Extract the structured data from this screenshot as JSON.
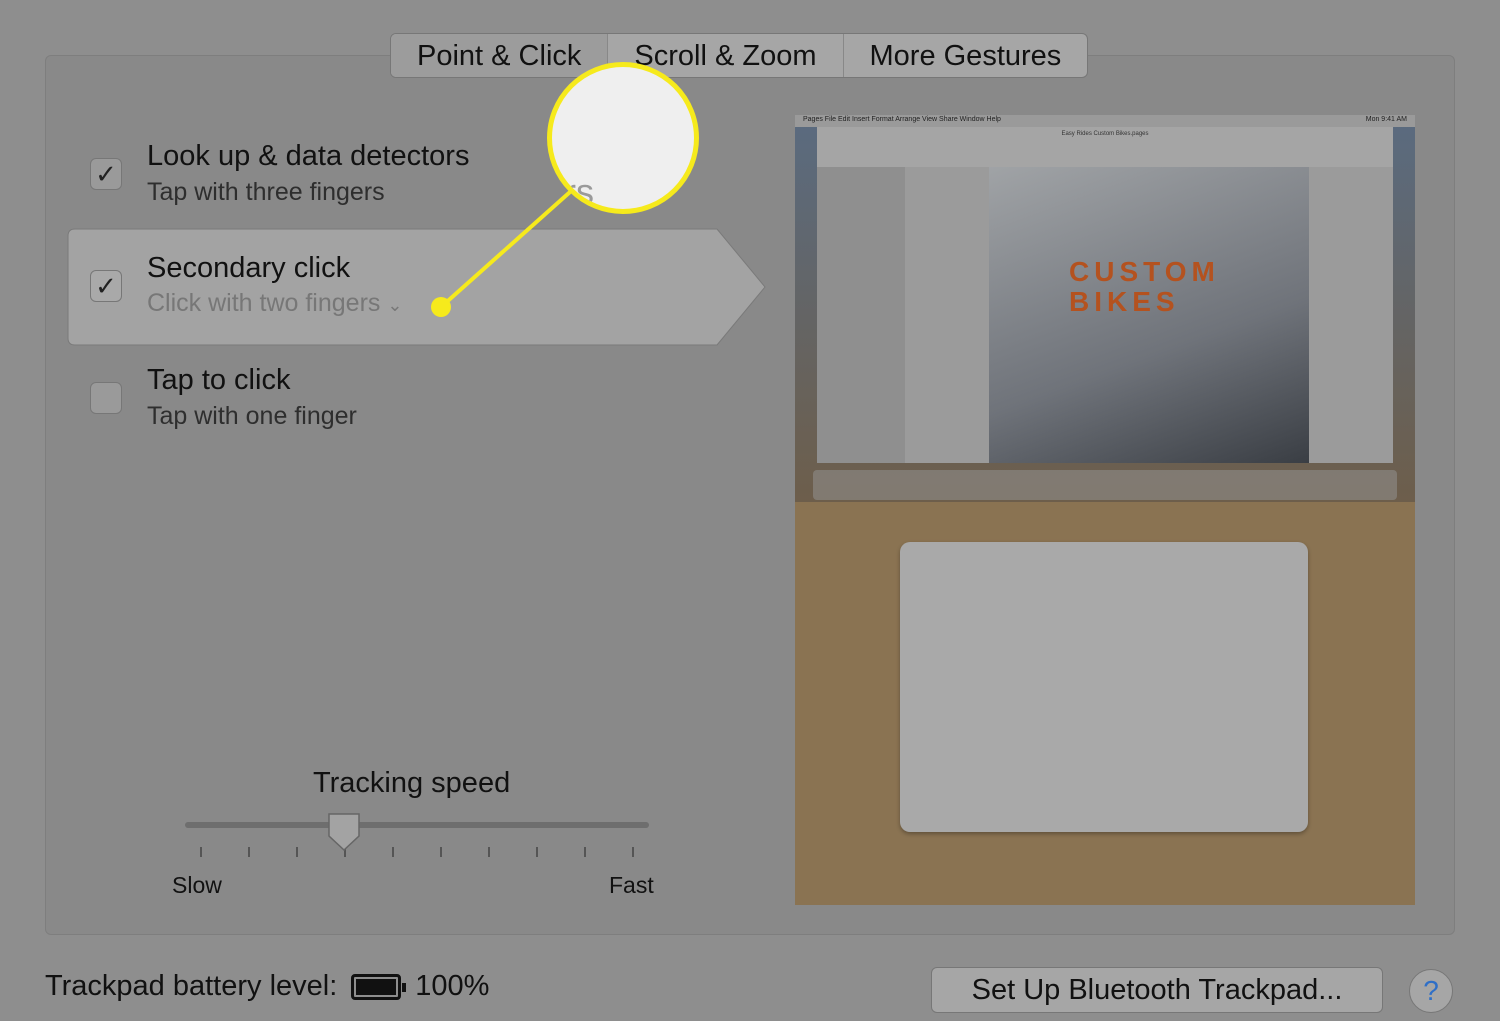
{
  "tabs": [
    {
      "label": "Point & Click",
      "active": true
    },
    {
      "label": "Scroll & Zoom"
    },
    {
      "label": "More Gestures"
    }
  ],
  "options": [
    {
      "title": "Look up & data detectors",
      "subtitle": "Tap with three fingers",
      "checked": true
    },
    {
      "title": "Secondary click",
      "subtitle": "Click with two fingers",
      "checked": true,
      "selected": true,
      "has_dropdown": true
    },
    {
      "title": "Tap to click",
      "subtitle": "Tap with one finger",
      "checked": false
    }
  ],
  "callout": {
    "text": "ers",
    "icon": "chevron-down-icon",
    "color": "#f6ea1c"
  },
  "tracking": {
    "label": "Tracking speed",
    "min_label": "Slow",
    "max_label": "Fast",
    "ticks": 10,
    "value_step": 3
  },
  "preview": {
    "menu": "Pages  File  Edit  Insert  Format  Arrange  View  Share  Window  Help",
    "clock": "Mon 9:41 AM",
    "doc_title": "Easy Rides Custom Bikes.pages",
    "headline": "CUSTOM BIKES"
  },
  "footer": {
    "battery_label": "Trackpad battery level:",
    "battery_value": "100%",
    "battery_fraction": 1.0,
    "setup_button": "Set Up Bluetooth Trackpad...",
    "help": "?"
  }
}
